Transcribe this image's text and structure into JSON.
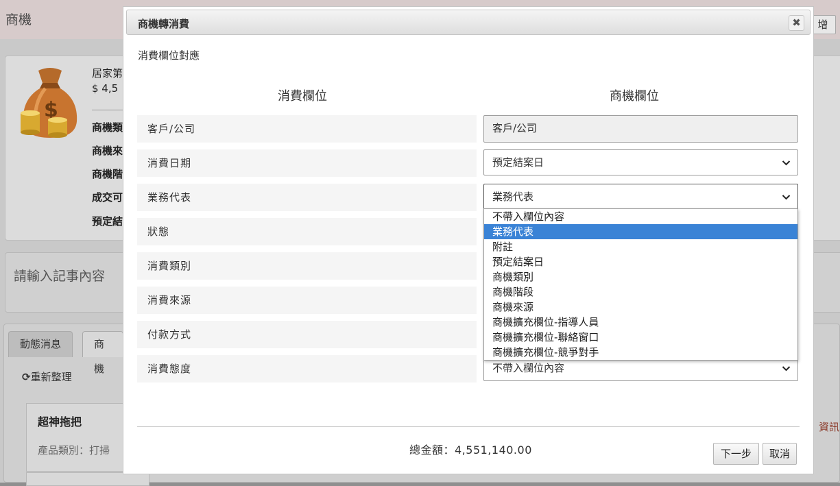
{
  "background": {
    "page_title": "商機",
    "add_button_label": "增",
    "opportunity_name": "居家第",
    "opportunity_amount": "$ 4,5",
    "field_labels": [
      "商機類",
      "商機來",
      "商機階",
      "成交可",
      "預定結"
    ],
    "note_placeholder": "請輸入記事內容",
    "tabs": [
      "動態消息",
      "商機"
    ],
    "refresh_label": "重新整理",
    "product_title": "超神拖把",
    "product_category": "產品類別：打掃",
    "info_link": "資訊"
  },
  "dialog": {
    "title": "商機轉消費",
    "close_symbol": "✖",
    "section_label": "消費欄位對應",
    "col_left_header": "消費欄位",
    "col_right_header": "商機欄位",
    "rows": [
      {
        "label": "客戶/公司",
        "value": "客戶/公司"
      },
      {
        "label": "消費日期",
        "value": "預定結案日"
      },
      {
        "label": "業務代表",
        "value": "業務代表"
      },
      {
        "label": "狀態",
        "value": ""
      },
      {
        "label": "消費類別",
        "value": ""
      },
      {
        "label": "消費來源",
        "value": ""
      },
      {
        "label": "付款方式",
        "value": ""
      },
      {
        "label": "消費態度",
        "value": "不帶入欄位內容"
      }
    ],
    "dropdown_options": [
      "不帶入欄位內容",
      "業務代表",
      "附註",
      "預定結案日",
      "商機類別",
      "商機階段",
      "商機來源",
      "商機擴充欄位-指導人員",
      "商機擴充欄位-聯絡窗口",
      "商機擴充欄位-競爭對手"
    ],
    "dropdown_selected": "業務代表",
    "total_label": "總金額：4,551,140.00",
    "next_button": "下一步",
    "cancel_button": "取消"
  },
  "colors": {
    "highlight": "#3a83d6",
    "overlay": "#c9c9c9"
  }
}
